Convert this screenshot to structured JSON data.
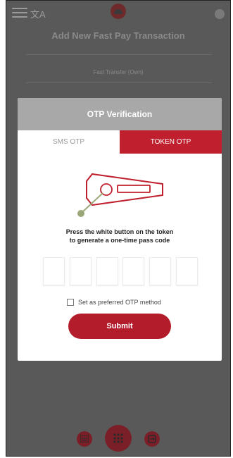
{
  "background": {
    "title": "Add New Fast Pay Transaction",
    "subtitle": "Fast Transfer (Own)"
  },
  "header_icons": {
    "menu": "hamburger-menu-icon",
    "language": "language-icon",
    "language_text": "文A",
    "logo": "bank-logo-icon",
    "profile": "profile-icon"
  },
  "modal": {
    "title": "OTP Verification",
    "tabs": [
      {
        "label": "SMS OTP",
        "active": false
      },
      {
        "label": "TOKEN OTP",
        "active": true
      }
    ],
    "instructions_line1": "Press the white button on the token",
    "instructions_line2": "to generate a one-time pass code",
    "otp_boxes": [
      "",
      "",
      "",
      "",
      "",
      ""
    ],
    "preferred_label": "Set as preferred OTP method",
    "preferred_checked": false,
    "submit_label": "Submit"
  },
  "bottom_nav": {
    "left": "bills-icon",
    "center": "grid-menu-icon",
    "right": "transfer-icon"
  },
  "colors": {
    "accent": "#c0202e",
    "submit": "#b31c2a",
    "overlay": "#595959",
    "header": "#a8a8a8"
  }
}
